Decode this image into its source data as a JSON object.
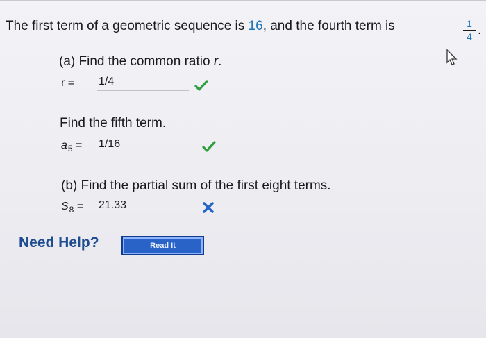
{
  "problem": {
    "statement_prefix": "The first term of a geometric sequence is",
    "first_term": "16",
    "statement_mid": ", and the fourth term is",
    "fourth_term_numerator": "1",
    "fourth_term_denominator": "4",
    "statement_suffix": "."
  },
  "part_a": {
    "label": "(a) Find the common ratio",
    "variable": "r",
    "period": ".",
    "r_label": "r =",
    "r_value": "1/4",
    "r_status": "correct",
    "fifth_prompt": "Find the fifth term.",
    "a5_label_base": "a",
    "a5_label_sub": "5",
    "a5_equals": "=",
    "a5_value": "1/16",
    "a5_status": "correct"
  },
  "part_b": {
    "label": "(b) Find the partial sum of the first eight terms.",
    "s8_label_base": "S",
    "s8_label_sub": "8",
    "s8_equals": "=",
    "s8_value": "21.33",
    "s8_status": "incorrect"
  },
  "help": {
    "label": "Need Help?",
    "button": "Read It"
  },
  "colors": {
    "correct": "#2f9e3e",
    "incorrect": "#2266c7",
    "link": "#1e4d8f"
  }
}
